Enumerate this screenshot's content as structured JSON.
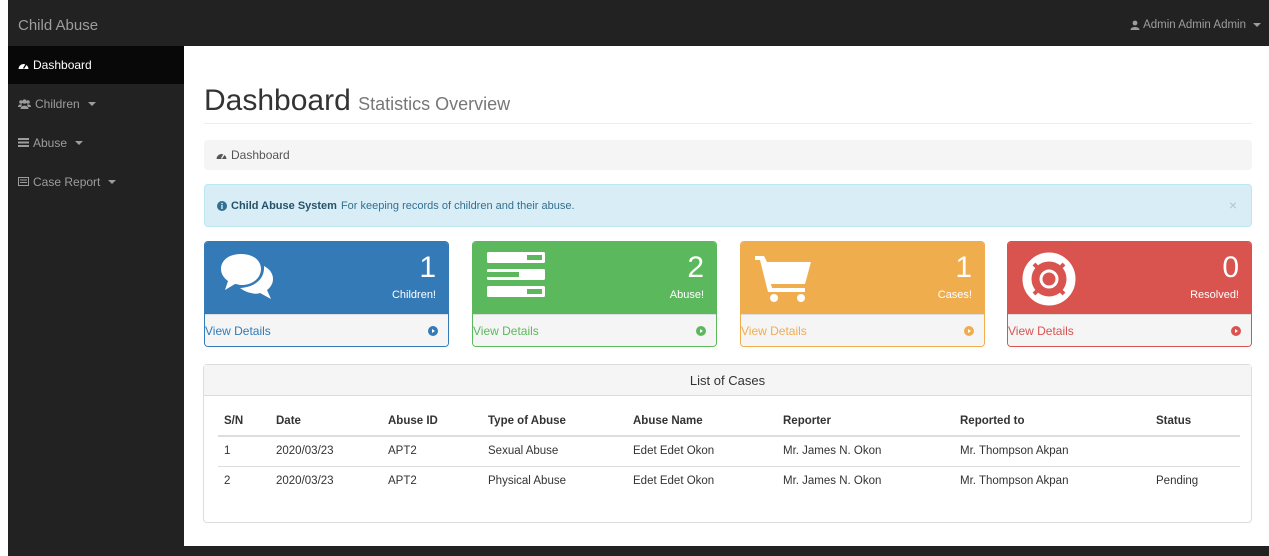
{
  "brand": "Child Abuse",
  "user": {
    "name": "Admin Admin Admin"
  },
  "sidebar": {
    "items": [
      {
        "label": "Dashboard"
      },
      {
        "label": "Children"
      },
      {
        "label": "Abuse"
      },
      {
        "label": "Case Report"
      }
    ]
  },
  "page": {
    "title": "Dashboard",
    "subtitle": "Statistics Overview"
  },
  "breadcrumb": {
    "label": "Dashboard"
  },
  "alert": {
    "bold": "Child Abuse System",
    "text": "For keeping records of children and their abuse.",
    "close": "×"
  },
  "panels": [
    {
      "count": "1",
      "label": "Children!",
      "link": "View Details",
      "color": "#337ab7",
      "icon": "comments-icon"
    },
    {
      "count": "2",
      "label": "Abuse!",
      "link": "View Details",
      "color": "#5cb85c",
      "icon": "tasks-icon"
    },
    {
      "count": "1",
      "label": "Cases!",
      "link": "View Details",
      "color": "#f0ad4e",
      "icon": "shopping-cart-icon"
    },
    {
      "count": "0",
      "label": "Resolved!",
      "link": "View Details",
      "color": "#d9534f",
      "icon": "life-ring-icon"
    }
  ],
  "cases": {
    "title": "List of Cases",
    "headers": [
      "S/N",
      "Date",
      "Abuse ID",
      "Type of Abuse",
      "Abuse Name",
      "Reporter",
      "Reported to",
      "Status"
    ],
    "rows": [
      [
        "1",
        "2020/03/23",
        "APT2",
        "Sexual Abuse",
        "Edet Edet Okon",
        "Mr. James N. Okon",
        "Mr. Thompson Akpan",
        ""
      ],
      [
        "2",
        "2020/03/23",
        "APT2",
        "Physical Abuse",
        "Edet Edet Okon",
        "Mr. James N. Okon",
        "Mr. Thompson Akpan",
        "Pending"
      ]
    ]
  }
}
